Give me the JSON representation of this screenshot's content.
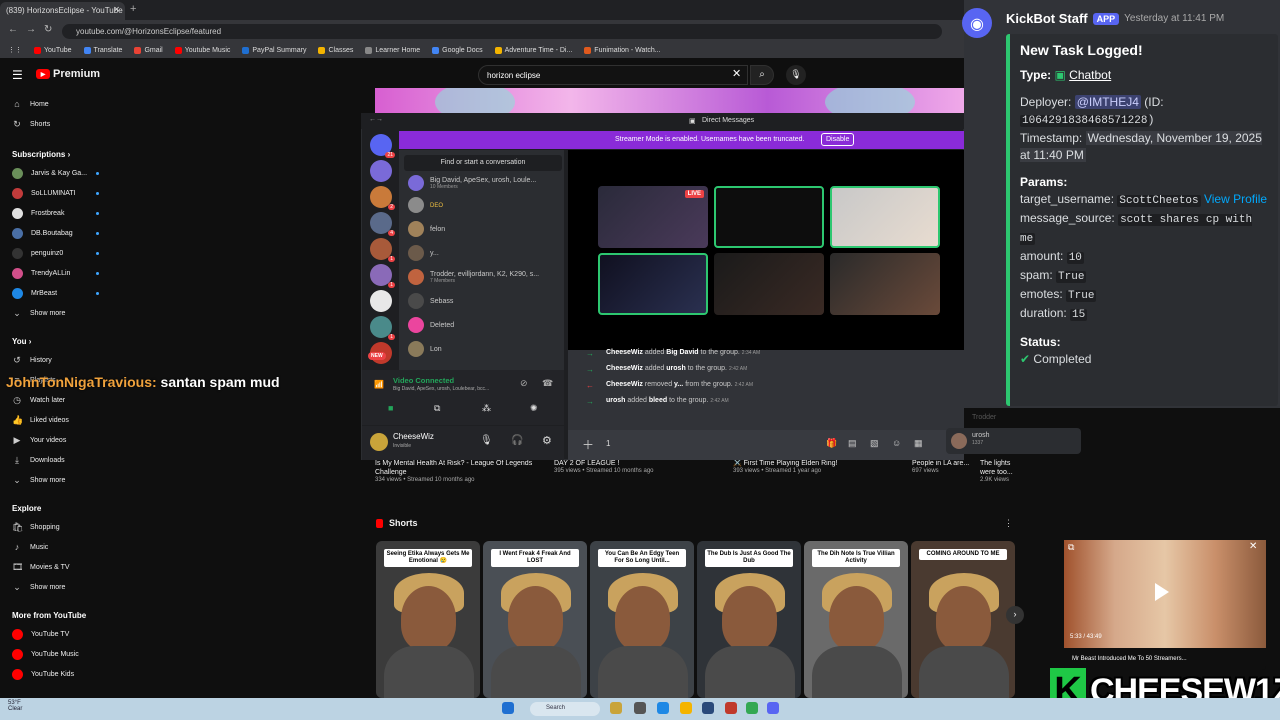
{
  "browser": {
    "tab_title": "(839) HorizonsEclipse - YouTube",
    "new_tab": "+",
    "url": "youtube.com/@HorizonsEclipse/featured",
    "bookmarks": [
      {
        "label": "YouTube",
        "color": "#ff0000"
      },
      {
        "label": "Translate",
        "color": "#4285f4"
      },
      {
        "label": "Gmail",
        "color": "#ea4335"
      },
      {
        "label": "Youtube Music",
        "color": "#ff0000"
      },
      {
        "label": "PayPal Summary",
        "color": "#1f6fd1"
      },
      {
        "label": "Classes",
        "color": "#f4b400"
      },
      {
        "label": "Learner Home",
        "color": "#888888"
      },
      {
        "label": "Google Docs",
        "color": "#4285f4"
      },
      {
        "label": "Adventure Time - Di...",
        "color": "#f4b400"
      },
      {
        "label": "Funimation - Watch...",
        "color": "#e05a1e"
      }
    ]
  },
  "youtube": {
    "logo_text": "Premium",
    "search_value": "horizon eclipse",
    "sidebar": {
      "main": [
        {
          "label": "Home",
          "icon": "home-icon",
          "glyph": "⌂"
        },
        {
          "label": "Shorts",
          "icon": "shorts-icon",
          "glyph": "↻"
        }
      ],
      "subscriptions_title": "Subscriptions",
      "subscriptions": [
        {
          "label": "Jarvis & Kay Ga...",
          "color": "#6a8f5a"
        },
        {
          "label": "SoLLUMINATI",
          "color": "#c23b3b"
        },
        {
          "label": "Frostbreak",
          "color": "#e0e0e0"
        },
        {
          "label": "DB.Boutabag",
          "color": "#4a6fa5"
        },
        {
          "label": "penguinz0",
          "color": "#333333"
        },
        {
          "label": "TrendyALLin",
          "color": "#d14f8a"
        },
        {
          "label": "MrBeast",
          "color": "#1e88e5"
        },
        {
          "label": "Show more",
          "color": ""
        }
      ],
      "you_title": "You",
      "you": [
        {
          "label": "History",
          "glyph": "↺",
          "icon": "history-icon"
        },
        {
          "label": "Playlists",
          "glyph": "≡",
          "icon": "playlists-icon"
        },
        {
          "label": "Watch later",
          "glyph": "◷",
          "icon": "clock-icon"
        },
        {
          "label": "Liked videos",
          "glyph": "👍",
          "icon": "like-icon"
        },
        {
          "label": "Your videos",
          "glyph": "▶",
          "icon": "video-icon"
        },
        {
          "label": "Downloads",
          "glyph": "⤓",
          "icon": "download-icon"
        },
        {
          "label": "Show more",
          "glyph": "⌄",
          "icon": "chevron-down-icon"
        }
      ],
      "explore_title": "Explore",
      "explore": [
        {
          "label": "Shopping",
          "glyph": "🛍",
          "icon": "shopping-icon"
        },
        {
          "label": "Music",
          "glyph": "♪",
          "icon": "music-icon"
        },
        {
          "label": "Movies & TV",
          "glyph": "🎞",
          "icon": "movies-icon"
        },
        {
          "label": "Show more",
          "glyph": "⌄",
          "icon": "chevron-down-icon"
        }
      ],
      "more_title": "More from YouTube",
      "more": [
        {
          "label": "YouTube TV",
          "color": "#ff0000"
        },
        {
          "label": "YouTube Music",
          "color": "#ff0000"
        },
        {
          "label": "YouTube Kids",
          "color": "#ff0000"
        }
      ]
    },
    "videos": [
      {
        "title": "Is My Mental Health At Risk? - League Of Legends Challenge",
        "meta": "334 views • Streamed 10 months ago"
      },
      {
        "title": "DAY 2 OF LEAGUE !",
        "meta": "395 views • Streamed 10 months ago"
      },
      {
        "title": "⚔️ First Time Playing Elden Ring!",
        "meta": "393 views • Streamed 1 year ago"
      },
      {
        "title": "People in LA are...",
        "meta": "697 views"
      },
      {
        "title": "The lights were too...",
        "meta": "2.9K views"
      }
    ],
    "shorts_title": "Shorts",
    "shorts": [
      {
        "caption": "Seeing Etika Always Gets Me Emotional 😢"
      },
      {
        "caption": "I Went Freak 4 Freak And LOST"
      },
      {
        "caption": "You Can Be An Edgy Teen For So Long Until..."
      },
      {
        "caption": "The Dub Is Just As Good The Dub"
      },
      {
        "caption": "The Dih Note Is True Villian Activity"
      },
      {
        "caption": "COMING AROUND TO ME"
      }
    ]
  },
  "discord_overlay": {
    "title": "Direct Messages",
    "streamer_banner": "Streamer Mode is enabled. Usernames have been truncated.",
    "disable_label": "Disable",
    "find_label": "Find or start a conversation",
    "dms": [
      {
        "name": "Big David, ApeSex, urosh, Loule...",
        "sub": "10 Members",
        "color": "#7a6ad8"
      },
      {
        "name": "",
        "sub": "",
        "tag": "DEO",
        "color": "#8b8b8b"
      },
      {
        "name": "felon",
        "sub": "",
        "color": "#a0825a"
      },
      {
        "name": "y...",
        "sub": "",
        "color": "#6b5a4a"
      },
      {
        "name": "Trodder, evilljordann, K2, K290, s...",
        "sub": "7 Members",
        "color": "#c0633f"
      },
      {
        "name": "Sebass",
        "sub": "",
        "color": "#4a4a4a"
      },
      {
        "name": "Deleted",
        "sub": "",
        "color": "#eb459e"
      },
      {
        "name": "Lon",
        "sub": "",
        "color": "#8a7a5a"
      }
    ],
    "live_label": "LIVE",
    "new_label": "NEW",
    "voice_status": "Video Connected",
    "voice_members": "Big David, ApeSex, urosh, Loulebear, bcc...",
    "user_name": "CheeseWiz",
    "user_status": "Invisible",
    "messages": [
      {
        "actor": "CheeseWiz",
        "verb": "added",
        "target": "Big David",
        "rest": "to the group.",
        "time": "2:34 AM",
        "dir": "add"
      },
      {
        "actor": "CheeseWiz",
        "verb": "added",
        "target": "urosh",
        "rest": "to the group.",
        "time": "2:42 AM",
        "dir": "add"
      },
      {
        "actor": "CheeseWiz",
        "verb": "removed",
        "target": "y...",
        "rest": "from the group.",
        "time": "2:42 AM",
        "dir": "remove"
      },
      {
        "actor": "urosh",
        "verb": "added",
        "target": "bleed",
        "rest": "to the group.",
        "time": "2:42 AM",
        "dir": "add"
      }
    ],
    "input_value": "1",
    "side_user_name": "urosh",
    "side_user_sub": "1337",
    "side_user_above": "Trodder"
  },
  "chat_overlay": {
    "username": "JohnTonNigaTravious:",
    "message": "santan spam mud"
  },
  "bot_message": {
    "bot_name": "KickBot Staff",
    "badge": "APP",
    "timestamp": "Yesterday at 11:41 PM",
    "embed_title": "New Task Logged!",
    "type_label": "Type:",
    "type_value": "Chatbot",
    "deployer_label": "Deployer:",
    "deployer_value": "@IMTHEJ4",
    "id_label": "(ID:",
    "id_value": "1064291838468571228",
    "id_close": ")",
    "timestamp_label": "Timestamp:",
    "timestamp_value": "Wednesday, November 19, 2025 at 11:40 PM",
    "params_label": "Params:",
    "target_label": "target_username:",
    "target_value": "ScottCheetos",
    "view_profile": "View Profile",
    "source_label": "message_source:",
    "source_value": "scott shares cp with me",
    "amount_label": "amount:",
    "amount_value": "10",
    "spam_label": "spam:",
    "spam_value": "True",
    "emotes_label": "emotes:",
    "emotes_value": "True",
    "duration_label": "duration:",
    "duration_value": "15",
    "status_label": "Status:",
    "status_value": "Completed",
    "accent": "#2dc770"
  },
  "miniplayer": {
    "title": "Mr Beast Introduced Me To 50 Streamers...",
    "time": "5:33 / 43:49"
  },
  "streamer_logo": {
    "letter": "K",
    "name": "CHEESEW1Z"
  },
  "taskbar": {
    "weather_temp": "53°F",
    "weather_desc": "Clear",
    "search_placeholder": "Search"
  }
}
